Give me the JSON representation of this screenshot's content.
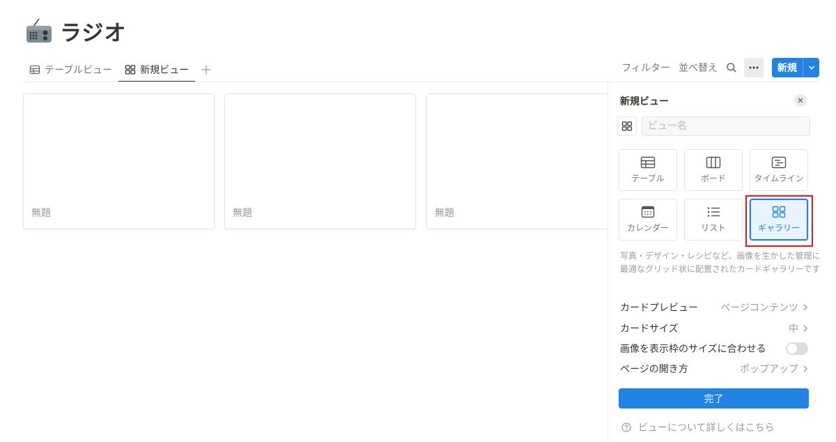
{
  "page": {
    "title": "ラジオ",
    "icon": "radio-icon"
  },
  "tabs": [
    {
      "label": "テーブルビュー",
      "icon": "table-icon",
      "active": false
    },
    {
      "label": "新規ビュー",
      "icon": "gallery-icon",
      "active": true
    }
  ],
  "toolbar": {
    "filter_label": "フィルター",
    "sort_label": "並べ替え",
    "new_label": "新規"
  },
  "cards": [
    {
      "title": "無題"
    },
    {
      "title": "無題"
    },
    {
      "title": "無題"
    }
  ],
  "panel": {
    "title": "新規ビュー",
    "name_placeholder": "ビュー名",
    "layouts": [
      {
        "label": "テーブル",
        "icon": "table-icon"
      },
      {
        "label": "ボード",
        "icon": "board-icon"
      },
      {
        "label": "タイムライン",
        "icon": "timeline-icon"
      },
      {
        "label": "カレンダー",
        "icon": "calendar-icon"
      },
      {
        "label": "リスト",
        "icon": "list-icon"
      },
      {
        "label": "ギャラリー",
        "icon": "gallery-icon",
        "selected": true
      }
    ],
    "description": "写真・デザイン・レシピなど、画像を生かした管理に最適なグリッド状に配置されたカードギャラリーです",
    "options": {
      "card_preview": {
        "label": "カードプレビュー",
        "value": "ページコンテンツ"
      },
      "card_size": {
        "label": "カードサイズ",
        "value": "中"
      },
      "fit_image": {
        "label": "画像を表示枠のサイズに合わせる",
        "enabled": false
      },
      "open_page": {
        "label": "ページの開き方",
        "value": "ポップアップ"
      }
    },
    "done_label": "完了",
    "help_label": "ビューについて詳しくはこちら"
  },
  "colors": {
    "accent": "#2383e2",
    "highlight": "#e0141c",
    "text": "#37352f",
    "muted": "#9b9a97"
  }
}
